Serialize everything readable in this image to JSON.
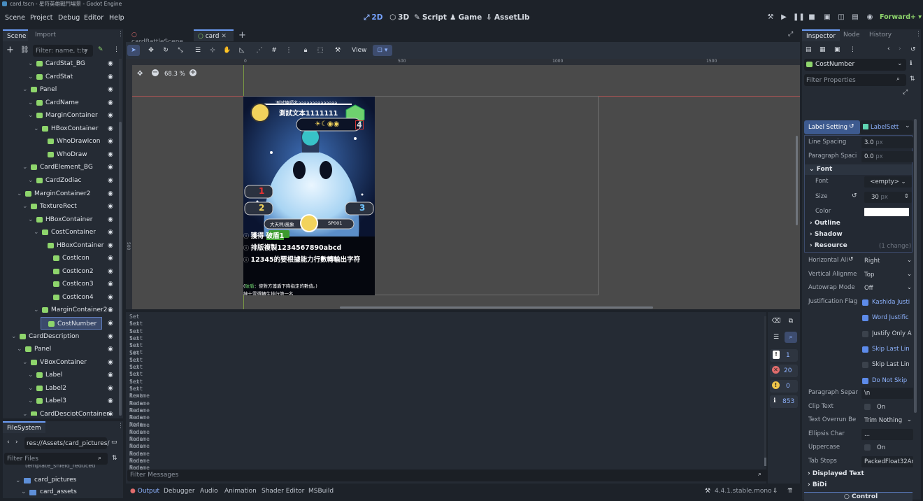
{
  "window": {
    "title": "card.tscn - 星符英雄戰鬥場景 - Godot Engine"
  },
  "menu": [
    "Scene",
    "Project",
    "Debug",
    "Editor",
    "Help"
  ],
  "workspaces": [
    "2D",
    "3D",
    "Script",
    "Game",
    "AssetLib"
  ],
  "renderer": "Forward+",
  "left": {
    "tabs": [
      "Scene",
      "Import"
    ],
    "filter_placeholder": "Filter: name, t:ty",
    "tree": [
      {
        "label": "CardStat_BG",
        "depth": 4,
        "icon": "green"
      },
      {
        "label": "CardStat",
        "depth": 4,
        "icon": "green"
      },
      {
        "label": "Panel",
        "depth": 3,
        "icon": "green"
      },
      {
        "label": "CardName",
        "depth": 4,
        "icon": "green"
      },
      {
        "label": "MarginContainer",
        "depth": 4,
        "icon": "green"
      },
      {
        "label": "HBoxContainer",
        "depth": 5,
        "icon": "green"
      },
      {
        "label": "WhoDrawIcon",
        "depth": 6,
        "icon": "green"
      },
      {
        "label": "WhoDraw",
        "depth": 6,
        "icon": "green"
      },
      {
        "label": "CardElement_BG",
        "depth": 3,
        "icon": "green"
      },
      {
        "label": "CardZodiac",
        "depth": 4,
        "icon": "green"
      },
      {
        "label": "MarginContainer2",
        "depth": 2,
        "icon": "green"
      },
      {
        "label": "TextureRect",
        "depth": 3,
        "icon": "green"
      },
      {
        "label": "HBoxContainer",
        "depth": 4,
        "icon": "green"
      },
      {
        "label": "CostContainer",
        "depth": 5,
        "icon": "green"
      },
      {
        "label": "HBoxContainer",
        "depth": 6,
        "icon": "green"
      },
      {
        "label": "CostIcon",
        "depth": 7,
        "icon": "green"
      },
      {
        "label": "CostIcon2",
        "depth": 7,
        "icon": "green"
      },
      {
        "label": "CostIcon3",
        "depth": 7,
        "icon": "green"
      },
      {
        "label": "CostIcon4",
        "depth": 7,
        "icon": "green"
      },
      {
        "label": "MarginContainer2",
        "depth": 5,
        "icon": "green"
      },
      {
        "label": "CostNumber",
        "depth": 6,
        "icon": "green",
        "selected": true
      },
      {
        "label": "CardDescription",
        "depth": 1,
        "icon": "green"
      },
      {
        "label": "Panel",
        "depth": 2,
        "icon": "green"
      },
      {
        "label": "VBoxContainer",
        "depth": 3,
        "icon": "green"
      },
      {
        "label": "Label",
        "depth": 4,
        "icon": "green"
      },
      {
        "label": "Label2",
        "depth": 4,
        "icon": "green"
      },
      {
        "label": "Label3",
        "depth": 4,
        "icon": "green"
      },
      {
        "label": "CardDesciptContainer",
        "depth": 3,
        "icon": "green"
      }
    ],
    "fs_tab": "FileSystem",
    "fs_path": "res://Assets/card_pictures/",
    "fs_filter": "Filter Files",
    "fs_items": [
      "template_shield_reduced",
      "card_pictures",
      "card_assets"
    ]
  },
  "center": {
    "tabs": [
      "cardBattleScene",
      "card"
    ],
    "view_label": "View",
    "zoom": "68.3 %",
    "ruler": [
      "0",
      "500",
      "1000",
      "1500"
    ],
    "ruler_v": "500",
    "card": {
      "author": "測試繪師名aaaaaaaaaaaaaa",
      "name": "測試文本1111111",
      "cost": "4",
      "atk": "1",
      "def": "2",
      "shield": "3",
      "zodiac": "大天秤/風象",
      "serial": "SP001",
      "lines": [
        "獲得",
        "破盾1",
        "排版複製1234567890abcd",
        "12345的要根據能力行數轉輸出字符"
      ],
      "foot1": "(破盾：使對方護盾下降指定的數值。)",
      "foot2": "紳士雲選轉生排行第一名",
      "foot_hl": "破盾"
    }
  },
  "output": {
    "lines": [
      "Set text",
      "Set text",
      "Set text",
      "Set text",
      "Set text",
      "Set text",
      "Set text",
      "Set text",
      "Set text",
      "Set text",
      "Set text",
      "Rename Node",
      "Rename Node",
      "Rename Node",
      "Rename Node",
      "Rename Node",
      "Rename Node",
      "Rename Node",
      "Rename Node",
      "Rename Node",
      "Rename Node",
      "Rename Node"
    ],
    "filter": "Filter Messages",
    "counts": {
      "info": "1",
      "errors": "20",
      "warnings": "0",
      "messages": "853"
    }
  },
  "bottom_tabs": [
    "Output",
    "Debugger",
    "Audio",
    "Animation",
    "Shader Editor",
    "MSBuild"
  ],
  "version": "4.4.1.stable.mono",
  "inspector": {
    "tabs": [
      "Inspector",
      "Node",
      "History"
    ],
    "node": "CostNumber",
    "filter": "Filter Properties",
    "label_setting": "Label Setting",
    "label_sett_res": "LabelSett",
    "line_spacing": {
      "label": "Line Spacing",
      "value": "3.0",
      "unit": "px"
    },
    "paragraph_spacing": {
      "label": "Paragraph Spaci",
      "value": "0.0",
      "unit": "px"
    },
    "font_section": "Font",
    "font": {
      "label": "Font",
      "value": "<empty>"
    },
    "size": {
      "label": "Size",
      "value": "30",
      "unit": "px"
    },
    "color": {
      "label": "Color",
      "value": "#ffffff"
    },
    "outline": "Outline",
    "shadow": "Shadow",
    "resource": "Resource",
    "change": "(1 change)",
    "h_align": {
      "label": "Horizontal Ali",
      "value": "Right"
    },
    "v_align": {
      "label": "Vertical Alignme",
      "value": "Top"
    },
    "autowrap": {
      "label": "Autowrap Mode",
      "value": "Off"
    },
    "just_label": "Justification Flag",
    "flags": [
      {
        "label": "Kashida Justi",
        "on": true
      },
      {
        "label": "Word Justific",
        "on": true
      },
      {
        "label": "Justify Only A",
        "on": false
      },
      {
        "label": "Skip Last Lin",
        "on": true
      },
      {
        "label": "Skip Last Lin",
        "on": false
      },
      {
        "label": "Do Not Skip",
        "on": true
      }
    ],
    "para_sep": {
      "label": "Paragraph Separ",
      "value": "\\n"
    },
    "clip_text": {
      "label": "Clip Text",
      "value": "On"
    },
    "overrun": {
      "label": "Text Overrun Be",
      "value": "Trim Nothing"
    },
    "ellipsis": {
      "label": "Ellipsis Char",
      "value": "..."
    },
    "uppercase": {
      "label": "Uppercase",
      "value": "On"
    },
    "tab_stops": {
      "label": "Tab Stops",
      "value": "PackedFloat32Ar"
    },
    "displayed_text": "Displayed Text",
    "bidi": "BiDi",
    "control": "Control"
  }
}
